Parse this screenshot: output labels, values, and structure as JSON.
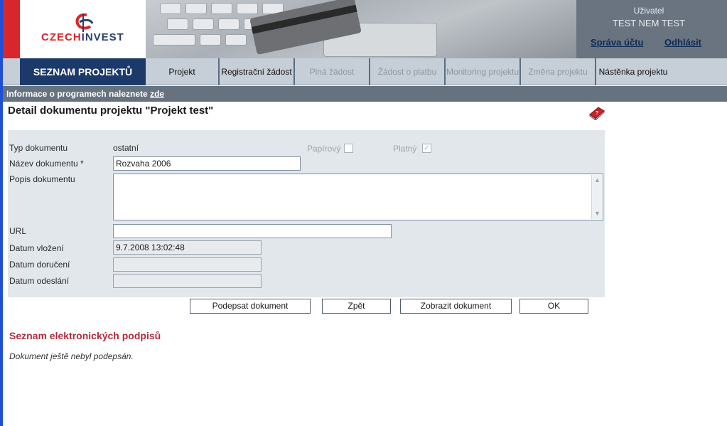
{
  "brand": {
    "name_prefix": "CZECH",
    "name_suffix": "INVEST"
  },
  "user": {
    "label": "Uživatel",
    "name": "TEST NEM TEST",
    "account_link": "Správa účtu",
    "logout_link": "Odhlásit"
  },
  "nav": {
    "title": "SEZNAM PROJEKTŮ",
    "tabs": [
      {
        "label": "Projekt",
        "state": "active"
      },
      {
        "label": "Registrační žádost",
        "state": "active"
      },
      {
        "label": "Plná žádost",
        "state": "disabled"
      },
      {
        "label": "Žádost o platbu",
        "state": "disabled"
      },
      {
        "label": "Monitoring projektu",
        "state": "disabled"
      },
      {
        "label": "Změna projektu",
        "state": "disabled"
      },
      {
        "label": "Nástěnka projektu",
        "state": "active"
      }
    ]
  },
  "info_bar": {
    "text": "Informace o programech naleznete ",
    "link": "zde"
  },
  "page": {
    "title": "Detail dokumentu projektu  \"Projekt test\""
  },
  "form": {
    "doc_type_label": "Typ dokumentu",
    "doc_type_value": "ostatní",
    "paper_label": "Papírový",
    "paper_checked": false,
    "valid_label": "Platný",
    "valid_checked": true,
    "name_label": "Název dokumentu *",
    "name_value": "Rozvaha 2006",
    "desc_label": "Popis dokumentu",
    "desc_value": "",
    "url_label": "URL",
    "url_value": "",
    "inserted_label": "Datum vložení",
    "inserted_value": "9.7.2008 13:02:48",
    "delivered_label": "Datum doručení",
    "delivered_value": "",
    "sent_label": "Datum odeslání",
    "sent_value": ""
  },
  "buttons": {
    "sign": "Podepsat dokument",
    "back": "Zpět",
    "show": "Zobrazit dokument",
    "ok": "OK"
  },
  "signatures": {
    "title": "Seznam elektronických podpisů",
    "empty_note": "Dokument ještě nebyl podepsán."
  },
  "colors": {
    "nav_title_bg": "#1b3a6a",
    "brand_red": "#d9262b",
    "signature_title": "#b52a3a",
    "info_bar_bg": "#66737f"
  }
}
